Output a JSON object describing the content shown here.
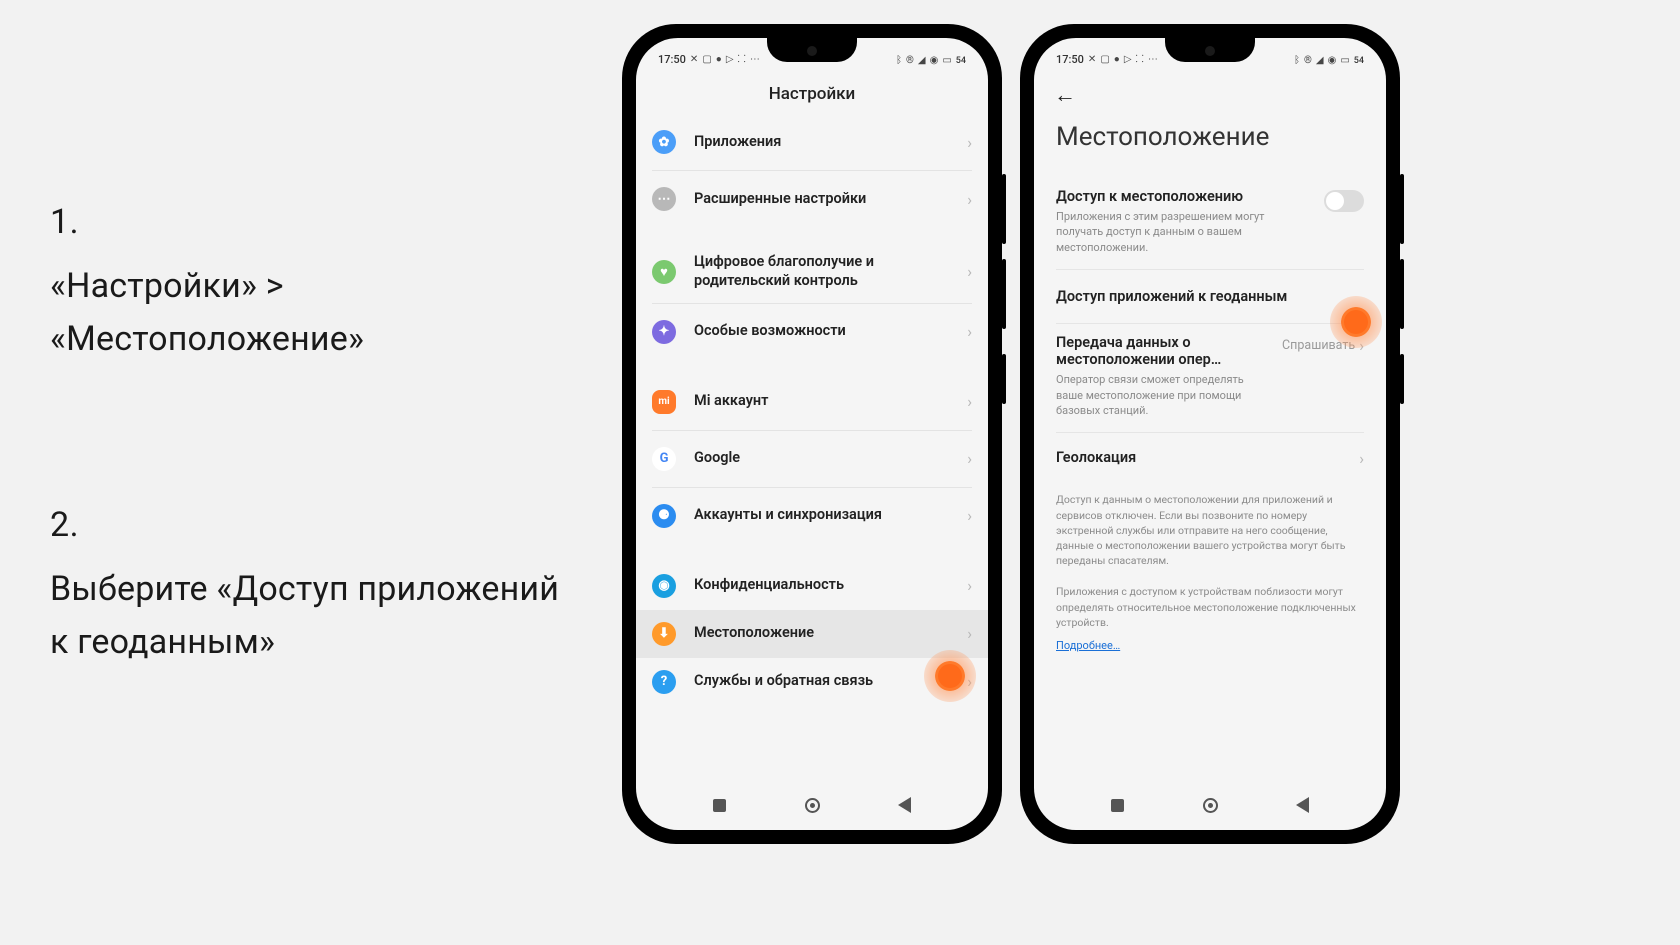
{
  "instructions": {
    "step1_num": "1.",
    "step1_text": "«Настройки» > «Местоположение»",
    "step2_num": "2.",
    "step2_text": "Выберите «Доступ приложений к геоданным»"
  },
  "status": {
    "time": "17:50",
    "battery": "54"
  },
  "screen1": {
    "title": "Настройки",
    "items": [
      {
        "label": "Приложения"
      },
      {
        "label": "Расширенные настройки"
      },
      {
        "label": "Цифровое благополучие и родительский контроль"
      },
      {
        "label": "Особые возможности"
      },
      {
        "label": "Mi аккаунт"
      },
      {
        "label": "Google"
      },
      {
        "label": "Аккаунты и синхронизация"
      },
      {
        "label": "Конфиденциальность"
      },
      {
        "label": "Местоположение"
      },
      {
        "label": "Службы и обратная связь"
      }
    ]
  },
  "screen2": {
    "title": "Местоположение",
    "access_title": "Доступ к местоположению",
    "access_sub": "Приложения с этим разрешением могут получать доступ к данным о вашем местоположении.",
    "app_access": "Доступ приложений к геоданным",
    "carrier_title": "Передача данных о местоположении опер…",
    "carrier_sub": "Оператор связи сможет определять ваше местоположение при помощи базовых станций.",
    "carrier_value": "Спрашивать",
    "geo": "Геолокация",
    "info1": "Доступ к данным о местоположении для приложений и сервисов отключен. Если вы позвоните по номеру экстренной службы или отправите на него сообщение, данные о местоположении вашего устройства могут быть переданы спасателям.",
    "info2": "Приложения с доступом к устройствам поблизости могут определять относительное местоположение подключенных устройств.",
    "more": "Подробнее…"
  }
}
